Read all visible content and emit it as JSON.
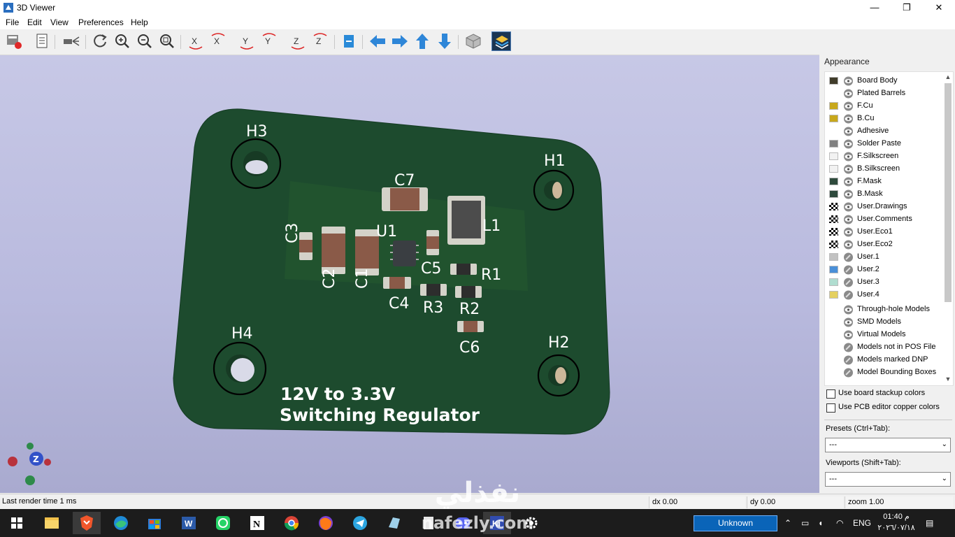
{
  "window": {
    "title": "3D Viewer",
    "minimize": "—",
    "maximize": "❐",
    "close": "✕"
  },
  "menu": [
    "File",
    "Edit",
    "View",
    "Preferences",
    "Help"
  ],
  "toolbar_icons": [
    "render-options-icon",
    "export-image-icon",
    "copy-to-clipboard-icon",
    "raytracing-icon",
    "reload-icon",
    "zoom-in-icon",
    "zoom-out-icon",
    "zoom-fit-icon",
    "rotate-x-cw-icon",
    "rotate-x-ccw-icon",
    "rotate-y-cw-icon",
    "rotate-y-ccw-icon",
    "rotate-z-cw-icon",
    "rotate-z-ccw-icon",
    "flip-board-icon",
    "move-left-icon",
    "move-right-icon",
    "move-up-icon",
    "move-down-icon",
    "orthographic-icon",
    "layers-manager-icon"
  ],
  "board": {
    "holes": [
      "H1",
      "H2",
      "H3",
      "H4"
    ],
    "components": [
      "C7",
      "U1",
      "L1",
      "C3",
      "C2",
      "C1",
      "C5",
      "R1",
      "C4",
      "R3",
      "R2",
      "C6"
    ],
    "silkscreen_text": [
      "12V to 3.3V",
      "Switching Regulator"
    ],
    "colors": {
      "soldermask": "#1d4b2e",
      "silkscreen": "#ffffff",
      "pad": "#d6d3c8",
      "body": "#8a5a48"
    }
  },
  "axis_labels": {
    "z": "Z"
  },
  "appearance": {
    "title": "Appearance",
    "layers": [
      {
        "name": "Board Body",
        "color": "#403c2a"
      },
      {
        "name": "Plated Barrels",
        "color": ""
      },
      {
        "name": "F.Cu",
        "color": "#c8a81c"
      },
      {
        "name": "B.Cu",
        "color": "#c8a81c"
      },
      {
        "name": "Adhesive",
        "color": ""
      },
      {
        "name": "Solder Paste",
        "color": "#808080"
      },
      {
        "name": "F.Silkscreen",
        "color": "#f2f2f2"
      },
      {
        "name": "B.Silkscreen",
        "color": "#f2f2f2"
      },
      {
        "name": "F.Mask",
        "color": "#2e4a3c"
      },
      {
        "name": "B.Mask",
        "color": "#2e4a3c"
      },
      {
        "name": "User.Drawings",
        "color": "checker"
      },
      {
        "name": "User.Comments",
        "color": "checker"
      },
      {
        "name": "User.Eco1",
        "color": "checker"
      },
      {
        "name": "User.Eco2",
        "color": "checker"
      },
      {
        "name": "User.1",
        "color": "#c2c2c2"
      },
      {
        "name": "User.2",
        "color": "#4a8fd8"
      },
      {
        "name": "User.3",
        "color": "#b0ddd0"
      },
      {
        "name": "User.4",
        "color": "#e4d060"
      }
    ],
    "models": [
      "Through-hole Models",
      "SMD Models",
      "Virtual Models",
      "Models not in POS File",
      "Models marked DNP",
      "Model Bounding Boxes"
    ],
    "use_stackup_colors": "Use board stackup colors",
    "use_pcb_copper_colors": "Use PCB editor copper colors",
    "presets_label": "Presets (Ctrl+Tab):",
    "presets_value": "---",
    "viewports_label": "Viewports (Shift+Tab):",
    "viewports_value": "---"
  },
  "status": {
    "render_time": "Last render time 1 ms",
    "dx": "dx 0.00",
    "dy": "dy 0.00",
    "zoom": "zoom 1.00"
  },
  "taskbar": {
    "apps": [
      "windows-start-icon",
      "file-explorer-icon",
      "brave-icon",
      "edge-icon",
      "store-icon",
      "word-icon",
      "whatsapp-icon",
      "notion-icon",
      "chrome-icon",
      "firefox-icon",
      "telegram-icon",
      "sticky-app-icon",
      "document-icon",
      "discord-icon",
      "kicad-icon",
      "settings-icon"
    ],
    "unknown_button": "Unknown",
    "language": "ENG",
    "time": "01:40 م",
    "date": "٢٠٢٦/٠٧/١٨"
  },
  "watermark": {
    "arabic": "نفذلي",
    "latin": "nafezly.com"
  }
}
